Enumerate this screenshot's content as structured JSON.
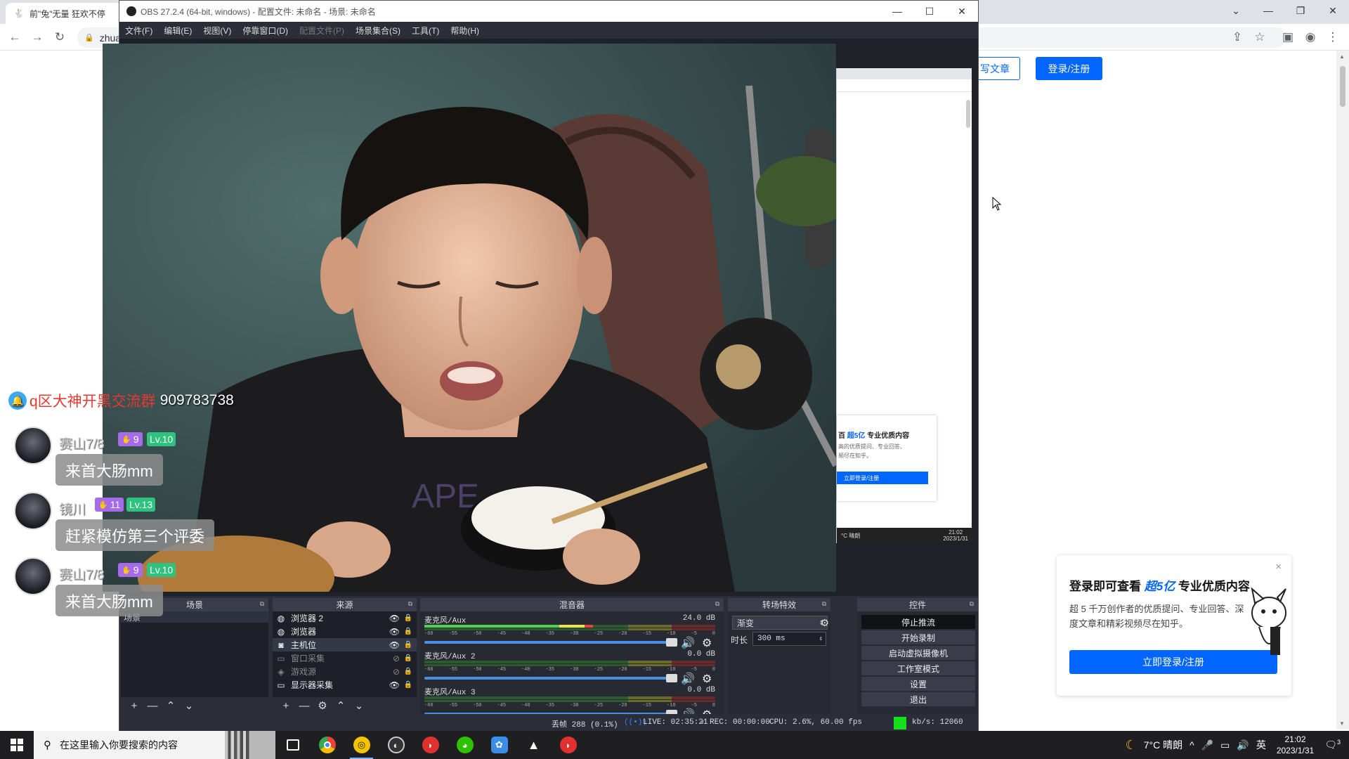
{
  "browser": {
    "tab_title": "前\"兔\"无量 狂欢不停",
    "url_fragment": "zhua",
    "controls": {
      "minimize": "—",
      "maximize": "❐",
      "close": "✕",
      "dropdown": "⌄"
    }
  },
  "zhihu": {
    "write_label": "写文章",
    "login_label": "登录/注册",
    "popup": {
      "title_prefix": "登录即可查看 ",
      "title_highlight": "超5亿",
      "title_suffix": " 专业优质内容",
      "description": "超 5 千万创作者的优质提问、专业回答、深度文章和精彩视频尽在知乎。",
      "cta": "立即登录/注册",
      "close": "×"
    }
  },
  "chat": {
    "group_prefix": "q区大神开黑交流群",
    "group_number": "909783738",
    "items": [
      {
        "name": "赛山7/8",
        "fan_level": "9",
        "level": "Lv.10",
        "message": "来首大肠mm"
      },
      {
        "name": "镜川",
        "fan_level": "11",
        "level": "Lv.13",
        "message": "赶紧模仿第三个评委"
      },
      {
        "name": "赛山7/8",
        "fan_level": "9",
        "level": "Lv.10",
        "message": "来首大肠mm"
      }
    ]
  },
  "obs": {
    "title": "OBS 27.2.4 (64-bit, windows) - 配置文件: 未命名 - 场景: 未命名",
    "menu": [
      {
        "label": "文件(F)",
        "disabled": false
      },
      {
        "label": "编辑(E)",
        "disabled": false
      },
      {
        "label": "视图(V)",
        "disabled": false
      },
      {
        "label": "停靠窗口(D)",
        "disabled": false
      },
      {
        "label": "配置文件(P)",
        "disabled": true
      },
      {
        "label": "场景集合(S)",
        "disabled": false
      },
      {
        "label": "工具(T)",
        "disabled": false
      },
      {
        "label": "帮助(H)",
        "disabled": false
      }
    ],
    "docks": {
      "scenes": {
        "title": "场景",
        "items": [
          "场景"
        ]
      },
      "sources": {
        "title": "来源",
        "items": [
          {
            "name": "浏览器 2",
            "icon": "globe-icon",
            "visible": true
          },
          {
            "name": "浏览器",
            "icon": "globe-icon",
            "visible": true
          },
          {
            "name": "主机位",
            "icon": "camera-icon",
            "visible": true
          },
          {
            "name": "窗口采集",
            "icon": "window-icon",
            "visible": false
          },
          {
            "name": "游戏源",
            "icon": "gamepad-icon",
            "visible": false
          },
          {
            "name": "显示器采集",
            "icon": "monitor-icon",
            "visible": true
          }
        ]
      },
      "mixer": {
        "title": "混音器",
        "channels": [
          {
            "name": "麦克风/Aux",
            "db": "24.0 dB",
            "level": 0.58
          },
          {
            "name": "麦克风/Aux 2",
            "db": "0.0 dB",
            "level": 0.0
          },
          {
            "name": "麦克风/Aux 3",
            "db": "0.0 dB",
            "level": 0.0
          }
        ],
        "scale": [
          "-60",
          "-55",
          "-50",
          "-45",
          "-40",
          "-35",
          "-30",
          "-25",
          "-20",
          "-15",
          "-10",
          "-5",
          "0"
        ]
      },
      "transitions": {
        "title": "转场特效",
        "type": "渐变",
        "duration_label": "时长",
        "duration": "300 ms"
      },
      "controls": {
        "title": "控件",
        "buttons": [
          "停止推流",
          "开始录制",
          "启动虚拟摄像机",
          "工作室模式",
          "设置",
          "退出"
        ]
      }
    },
    "status": {
      "dropped": "丢帧 288 (0.1%)",
      "live": "LIVE: 02:35:21",
      "rec": "REC: 00:00:00",
      "cpu": "CPU: 2.6%, 60.00 fps",
      "kbps": "kb/s: 12060"
    },
    "preview_mini": {
      "popup_title_prefix": "百 ",
      "popup_title_highlight": "超5亿",
      "popup_title_suffix": " 专业优质内容",
      "popup_desc": "高的优质提问、专业回答、频尽在知乎。",
      "popup_cta": "立即登录/注册",
      "taskbar_left": "°C 晴朗",
      "taskbar_time": "21:02",
      "taskbar_date": "2023/1/31"
    }
  },
  "taskbar": {
    "search_placeholder": "在这里输入你要搜索的内容",
    "weather": "7°C 晴朗",
    "ime": "英",
    "time": "21:02",
    "date": "2023/1/31",
    "notification_count": "3"
  }
}
